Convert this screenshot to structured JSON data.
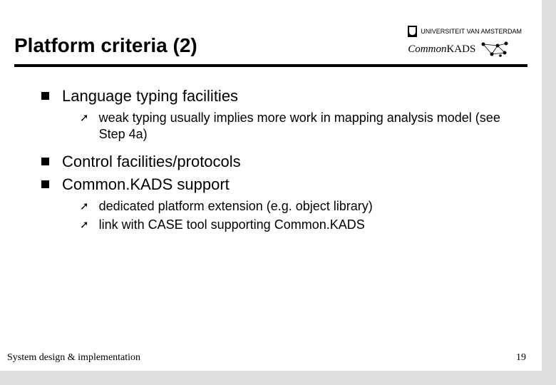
{
  "header": {
    "title": "Platform criteria (2)",
    "uva_text": "UNIVERSITEIT VAN AMSTERDAM",
    "ck_text_italic": "Common",
    "ck_text_plain": "KADS"
  },
  "bullets": {
    "b1": "Language typing facilities",
    "b1_sub1": "weak typing usually implies more work in mapping analysis model (see Step 4a)",
    "b2": "Control facilities/protocols",
    "b3": "Common.KADS support",
    "b3_sub1": "dedicated platform extension (e.g. object library)",
    "b3_sub2": "link with CASE tool supporting Common.KADS"
  },
  "footer": {
    "left": "System design & implementation",
    "page": "19"
  }
}
